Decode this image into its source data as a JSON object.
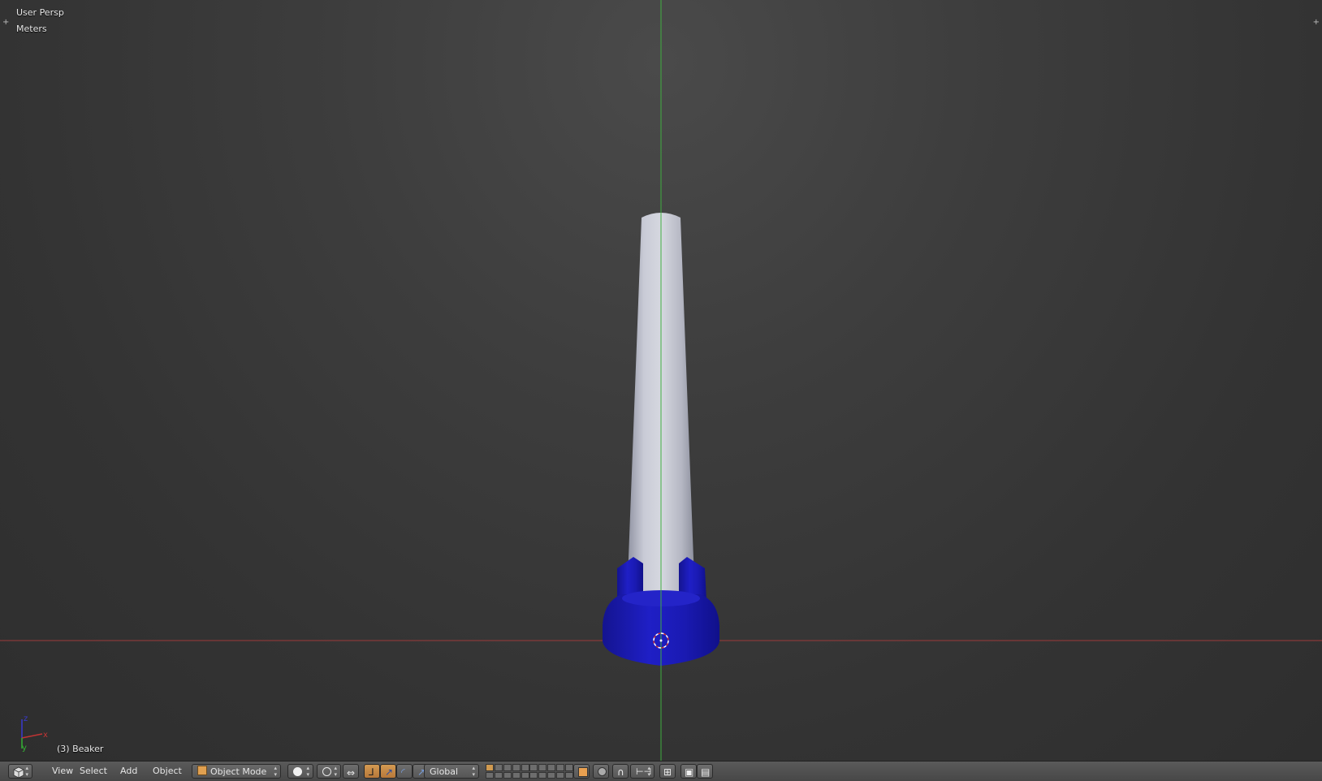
{
  "viewport": {
    "view_label": "User Persp",
    "units_label": "Meters",
    "active_object_label": "(3) Beaker",
    "axis_labels": {
      "x": "x",
      "y": "y"
    },
    "colors": {
      "x_axis": "#b04040",
      "y_axis": "#3fae3f",
      "tube": "#c8cad6",
      "base": "#1e1ec8"
    }
  },
  "header": {
    "menus": [
      "View",
      "Select",
      "Add",
      "Object"
    ],
    "mode_dropdown": "Object Mode",
    "orientation_dropdown": "Global"
  }
}
